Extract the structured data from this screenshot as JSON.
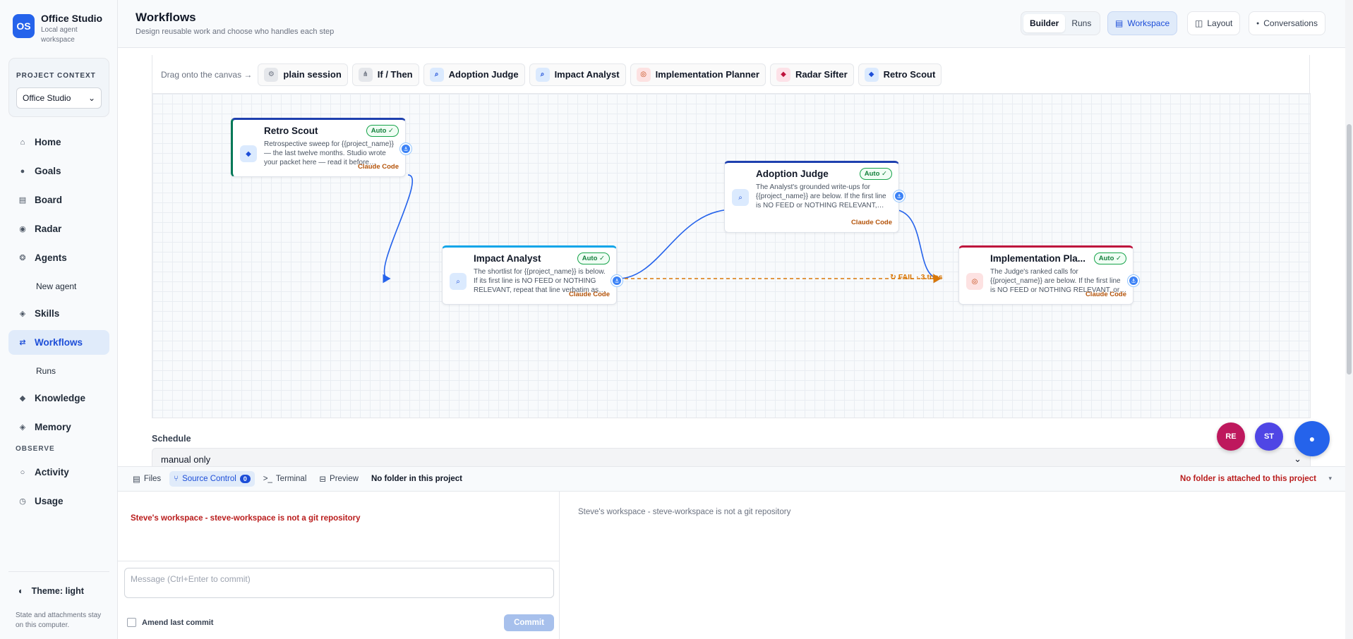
{
  "brand": {
    "logo": "OS",
    "name": "Office Studio",
    "subtitle": "Local agent workspace"
  },
  "project_context": {
    "title": "PROJECT CONTEXT",
    "selected": "Office Studio"
  },
  "nav": {
    "home": "Home",
    "goals": "Goals",
    "board": "Board",
    "radar": "Radar",
    "agents": "Agents",
    "new_agent": "New agent",
    "skills": "Skills",
    "workflows": "Workflows",
    "runs": "Runs",
    "knowledge": "Knowledge",
    "memory": "Memory",
    "observe_section": "OBSERVE",
    "activity": "Activity",
    "usage": "Usage"
  },
  "theme": {
    "label": "Theme: light"
  },
  "footer_note": "State and attachments stay on this computer.",
  "header": {
    "title": "Workflows",
    "subtitle": "Design reusable work and choose who handles each step"
  },
  "toolbar": {
    "builder": "Builder",
    "runs": "Runs",
    "workspace": "Workspace",
    "layout": "Layout",
    "conversations": "Conversations"
  },
  "palette": {
    "label": "Drag onto the canvas →",
    "items": [
      {
        "label": "plain session",
        "icon": "gear-icon",
        "color": "#e5e7eb"
      },
      {
        "label": "If / Then",
        "icon": "fork-icon",
        "color": "#e5e7eb"
      },
      {
        "label": "Adoption Judge",
        "icon": "magnifier-icon",
        "color": "#dbeafe"
      },
      {
        "label": "Impact Analyst",
        "icon": "magnifier-icon",
        "color": "#dbeafe"
      },
      {
        "label": "Implementation Planner",
        "icon": "target-icon",
        "color": "#fde2e2"
      },
      {
        "label": "Radar Sifter",
        "icon": "diamond-icon",
        "color": "#fde2e8"
      },
      {
        "label": "Retro Scout",
        "icon": "diamond-icon",
        "color": "#dbeafe"
      }
    ]
  },
  "nodes": [
    {
      "id": "retro",
      "title": "Retro Scout",
      "badge": "Auto ✓",
      "desc": "Retrospective sweep for {{project_name}} — the last twelve months. Studio wrote your packet here — read it before…",
      "engine": "Claude Code",
      "icon": "diamond-icon",
      "color": "#047857"
    },
    {
      "id": "impact",
      "title": "Impact Analyst",
      "badge": "Auto ✓",
      "desc": "The shortlist for {{project_name}} is below. If its first line is NO FEED or NOTHING RELEVANT, repeat that line verbatim as…",
      "engine": "Claude Code",
      "icon": "magnifier-icon",
      "color": "#0ea5e9"
    },
    {
      "id": "adoption",
      "title": "Adoption Judge",
      "badge": "Auto ✓",
      "desc": "The Analyst's grounded write-ups for {{project_name}} are below. If the first line is NO FEED or NOTHING RELEVANT,…",
      "engine": "Claude Code",
      "icon": "magnifier-icon",
      "color": "#1e40af"
    },
    {
      "id": "planner",
      "title": "Implementation Pla...",
      "badge": "Auto ✓",
      "desc": "The Judge's ranked calls for {{project_name}} are below. If the first line is NO FEED or NOTHING RELEVANT, or…",
      "engine": "Claude Code",
      "icon": "target-icon",
      "color": "#be123c"
    }
  ],
  "edges": {
    "fail_label": "↻ FAIL · 3 tries"
  },
  "schedule": {
    "label": "Schedule",
    "value": "manual only"
  },
  "avatars": [
    "RE",
    "ST",
    "●"
  ],
  "panel": {
    "tabs": {
      "files": "Files",
      "source_control": "Source Control",
      "source_count": "0",
      "terminal": "Terminal",
      "preview": "Preview"
    },
    "folder": "No folder in this project",
    "warning": "No folder is attached to this project",
    "error": "Steve's workspace - steve-workspace is not a git repository",
    "message_placeholder": "Message (Ctrl+Enter to commit)",
    "amend": "Amend last commit",
    "commit": "Commit",
    "right_text": "Steve's workspace - steve-workspace is not a git repository"
  }
}
